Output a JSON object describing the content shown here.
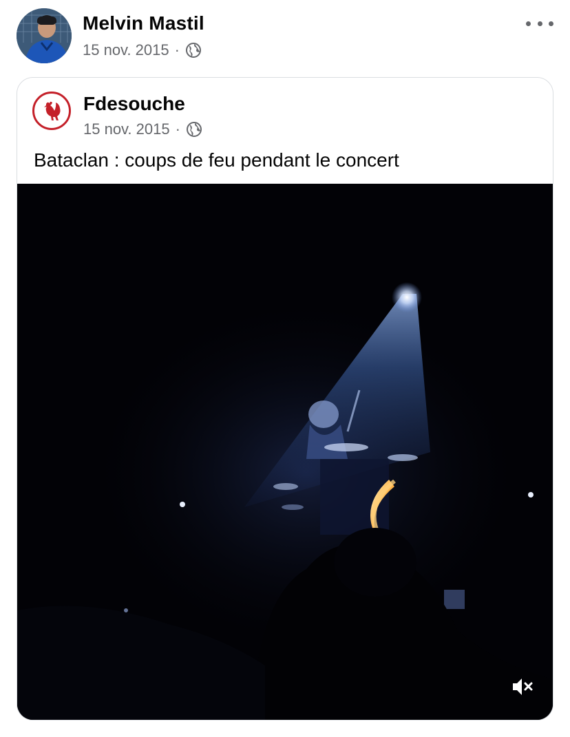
{
  "post": {
    "author": "Melvin Mastil",
    "date": "15 nov. 2015",
    "separator": "·",
    "privacy_icon": "globe-icon",
    "more_icon": "more-options-icon"
  },
  "shared": {
    "page_name": "Fdesouche",
    "date": "15 nov. 2015",
    "separator": "·",
    "privacy_icon": "globe-icon",
    "logo_icon": "rooster-icon",
    "text": "Bataclan : coups de feu pendant le concert",
    "video": {
      "mute_icon": "speaker-muted-icon"
    }
  },
  "colors": {
    "brand_red": "#c42029",
    "secondary_text": "#65676b",
    "card_border": "#dadde1"
  }
}
